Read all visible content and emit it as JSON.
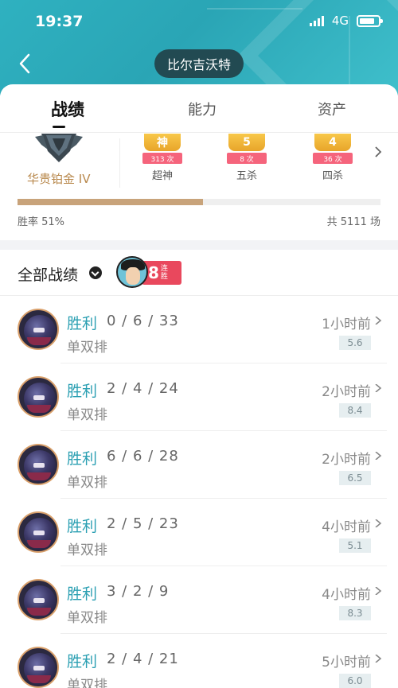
{
  "status_bar": {
    "time": "19:37",
    "network": "4G"
  },
  "header": {
    "title": "比尔吉沃特"
  },
  "tabs": [
    {
      "label": "战绩",
      "active": true
    },
    {
      "label": "能力",
      "active": false
    },
    {
      "label": "资产",
      "active": false
    }
  ],
  "rank": {
    "name": "华贵铂金 IV"
  },
  "badges": [
    {
      "medal": "神",
      "count": "313 次",
      "label": "超神"
    },
    {
      "medal": "5",
      "count": "8 次",
      "label": "五杀"
    },
    {
      "medal": "4",
      "count": "36 次",
      "label": "四杀"
    }
  ],
  "stats": {
    "win_rate_label": "胜率 51%",
    "win_rate": 0.51,
    "total_label": "共 5111 场"
  },
  "filter": {
    "label": "全部战绩",
    "streak_number": "8",
    "streak_text": "连胜"
  },
  "matches": [
    {
      "result": "胜利",
      "kda": "0 / 6 / 33",
      "mode": "单双排",
      "time": "1小时前",
      "score": "5.6"
    },
    {
      "result": "胜利",
      "kda": "2 / 4 / 24",
      "mode": "单双排",
      "time": "2小时前",
      "score": "8.4"
    },
    {
      "result": "胜利",
      "kda": "6 / 6 / 28",
      "mode": "单双排",
      "time": "2小时前",
      "score": "6.5"
    },
    {
      "result": "胜利",
      "kda": "2 / 5 / 23",
      "mode": "单双排",
      "time": "4小时前",
      "score": "5.1"
    },
    {
      "result": "胜利",
      "kda": "3 / 2 / 9",
      "mode": "单双排",
      "time": "4小时前",
      "score": "8.3"
    },
    {
      "result": "胜利",
      "kda": "2 / 4 / 21",
      "mode": "单双排",
      "time": "5小时前",
      "score": "6.0"
    }
  ],
  "colors": {
    "header": "#2fb1c0",
    "accent": "#2a9fb2",
    "rank": "#b8884c",
    "progress": "#c8a37a",
    "streak": "#e9485d"
  }
}
